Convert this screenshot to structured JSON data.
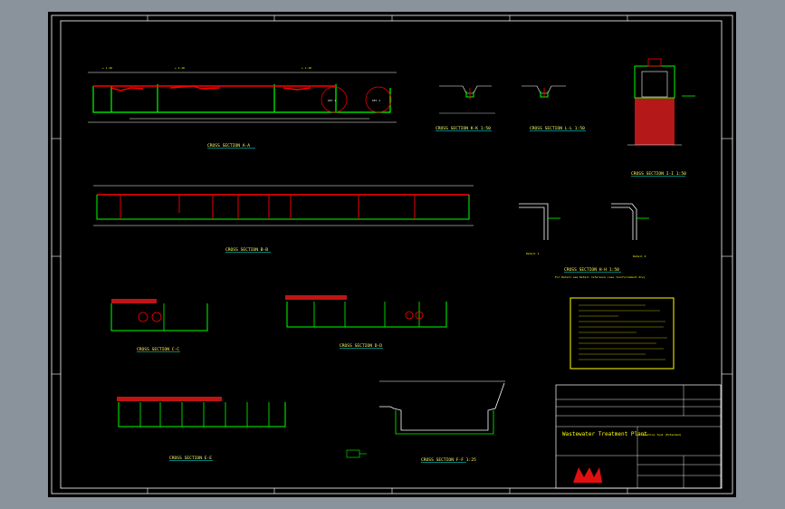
{
  "drawing": {
    "sections": {
      "a": "CROSS SECTION A-A",
      "b": "CROSS SECTION B-B",
      "c": "CROSS SECTION C-C",
      "d": "CROSS SECTION D-D",
      "e": "CROSS SECTION E-E",
      "f": "CROSS SECTION F-F 1:25",
      "h": "CROSS SECTION H-H 1:50",
      "i": "CROSS SECTION I-I 1:50",
      "k": "CROSS SECTION K-K 1:50",
      "l": "CROSS SECTION L-L 1:50"
    },
    "details": {
      "detail1": "Detail 1",
      "detail2": "Detail 2",
      "note": "For Detail see Detail reference (see reinforcement drw)"
    },
    "callouts": {
      "det1": "DET 1",
      "det2": "DET 2"
    },
    "colors": {
      "background": "#000000",
      "frame": "#ffffff",
      "concrete": "#00ff00",
      "steel": "#ff0000",
      "dimension": "#ffffff",
      "text": "#ffff00",
      "hatch": "#ff2000"
    },
    "title_block": {
      "project": "Wastewater Treatment Plant",
      "subtitle": "Aeration Tank (Extended)",
      "logo": "logo"
    }
  }
}
